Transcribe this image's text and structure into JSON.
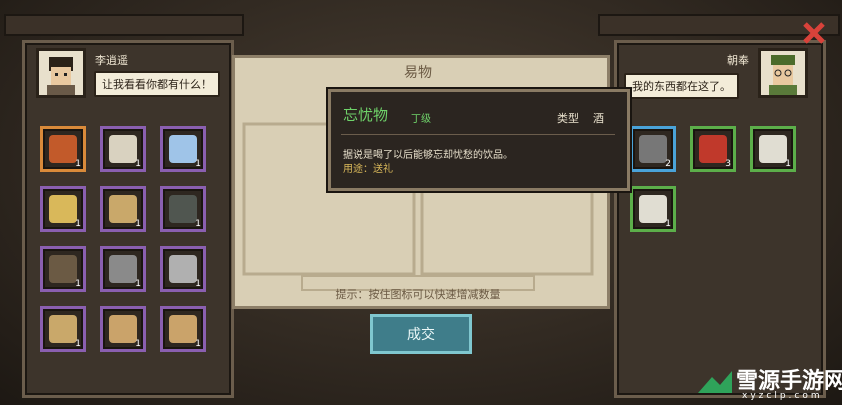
{
  "left": {
    "name": "李逍遥",
    "speech": "让我看看你都有什么！",
    "items": [
      {
        "icon": "red-box-icon",
        "count": "1",
        "color": "#c25a2a",
        "border": "orange"
      },
      {
        "icon": "knife-icon",
        "count": "1",
        "color": "#d9d2c0",
        "border": "purple"
      },
      {
        "icon": "crystal-icon",
        "count": "1",
        "color": "#9fc4e8",
        "border": "purple"
      },
      {
        "icon": "gold-nugget-icon",
        "count": "1",
        "color": "#d9b85a",
        "border": "purple"
      },
      {
        "icon": "scroll-bundle-icon",
        "count": "1",
        "color": "#c9a86a",
        "border": "purple"
      },
      {
        "icon": "black-leaf-icon",
        "count": "1",
        "color": "#505650",
        "border": "purple"
      },
      {
        "icon": "jar-icon",
        "count": "1",
        "color": "#6b5a44",
        "border": "purple"
      },
      {
        "icon": "iron-bar-icon",
        "count": "1",
        "color": "#8a8a8a",
        "border": "purple"
      },
      {
        "icon": "key-icon",
        "count": "1",
        "color": "#b0b0b0",
        "border": "purple"
      },
      {
        "icon": "scroll-icon",
        "count": "1",
        "color": "#c9a86a",
        "border": "purple"
      },
      {
        "icon": "map-tile-icon",
        "count": "1",
        "color": "#caa36a",
        "border": "purple"
      },
      {
        "icon": "map-tile-icon",
        "count": "1",
        "color": "#caa36a",
        "border": "purple"
      }
    ]
  },
  "center": {
    "title": "易物",
    "hint": "提示：按住图标可以快速增减数量",
    "trade_label": "成交"
  },
  "tooltip": {
    "name": "忘忧物",
    "grade": "丁级",
    "type_label": "类型",
    "type_value": "酒",
    "desc": "据说是喝了以后能够忘却忧愁的饮品。",
    "use": "用途：送礼"
  },
  "right": {
    "name": "朝奉",
    "speech": "我的东西都在这了。",
    "items": [
      {
        "icon": "stones-icon",
        "count": "2",
        "color": "#777",
        "border": "blue"
      },
      {
        "icon": "red-meat-icon",
        "count": "3",
        "color": "#c0392b",
        "border": "green"
      },
      {
        "icon": "bowl-icon",
        "count": "1",
        "color": "#e0ddd2",
        "border": "green"
      },
      {
        "icon": "bowl-icon",
        "count": "1",
        "color": "#e0ddd2",
        "border": "green"
      }
    ]
  },
  "watermark": {
    "title": "雪源手游网",
    "url": "xyzclp.com"
  }
}
